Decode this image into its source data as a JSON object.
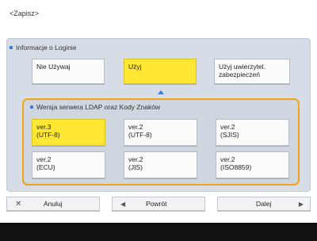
{
  "header": {
    "title": "<Zapisz>"
  },
  "login_section": {
    "label": "Informacje o Loginie",
    "options": [
      {
        "label": "Nie Używaj",
        "selected": false
      },
      {
        "label": "Użyj",
        "selected": true
      },
      {
        "label": "Użyj uwierzytel. zabezpieczeń",
        "selected": false
      }
    ]
  },
  "ldap_section": {
    "label": "Wersja serwera LDAP oraz Kody Znaków",
    "options": [
      {
        "label": "ver.3 (UTF-8)",
        "selected": true
      },
      {
        "label": "ver.2 (UTF-8)",
        "selected": false
      },
      {
        "label": "ver.2 (SJIS)",
        "selected": false
      },
      {
        "label": "ver.2 (ECU)",
        "selected": false
      },
      {
        "label": "ver.2 (JIS)",
        "selected": false
      },
      {
        "label": "ver.2 (ISO8859)",
        "selected": false
      }
    ]
  },
  "footer": {
    "cancel_label": "Anuluj",
    "back_label": "Powrót",
    "next_label": "Dalej"
  },
  "colors": {
    "selected": "#ffe733",
    "accent": "#3a7bd5",
    "highlight_border": "#f0a21a"
  },
  "icons": {
    "cancel": "close-icon",
    "back": "arrow-left-icon",
    "next": "arrow-right-icon",
    "pointer": "triangle-up-icon"
  }
}
